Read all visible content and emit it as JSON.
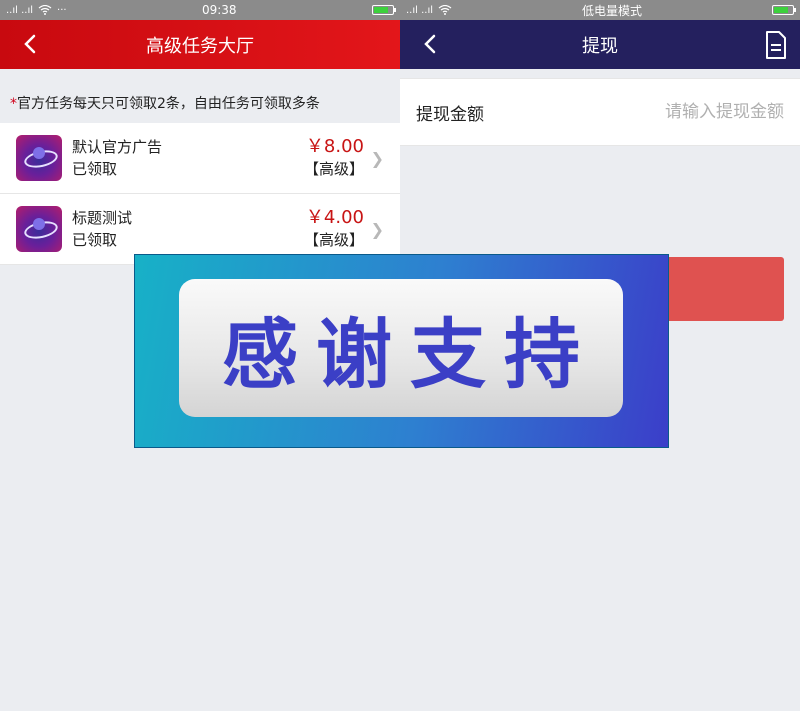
{
  "left": {
    "status": {
      "signal": "..ıl ..ıl",
      "time": "09:38"
    },
    "nav": {
      "title": "高级任务大厅"
    },
    "notice": {
      "star": "*",
      "text": "官方任务每天只可领取2条，自由任务可领取多条"
    },
    "tasks": [
      {
        "title": "默认官方广告",
        "status": "已领取",
        "price": "￥8.00",
        "level": "【高级】"
      },
      {
        "title": "标题测试",
        "status": "已领取",
        "price": "￥4.00",
        "level": "【高级】"
      }
    ]
  },
  "right": {
    "status": {
      "signal": "..ıl ..ıl",
      "mode": "低电量模式"
    },
    "nav": {
      "title": "提现"
    },
    "form": {
      "amount_label": "提现金额",
      "amount_placeholder": "请输入提现金额",
      "amount_value": ""
    }
  },
  "overlay": {
    "text": "感谢支持"
  },
  "colors": {
    "left_nav": "#d50f14",
    "right_nav": "#24205e",
    "price": "#c81414",
    "submit": "#df5250",
    "overlay_text": "#3b3fc6"
  },
  "icons": [
    "back-icon",
    "document-icon",
    "chevron-right-icon",
    "wifi-icon",
    "battery-icon",
    "task-app-icon"
  ]
}
